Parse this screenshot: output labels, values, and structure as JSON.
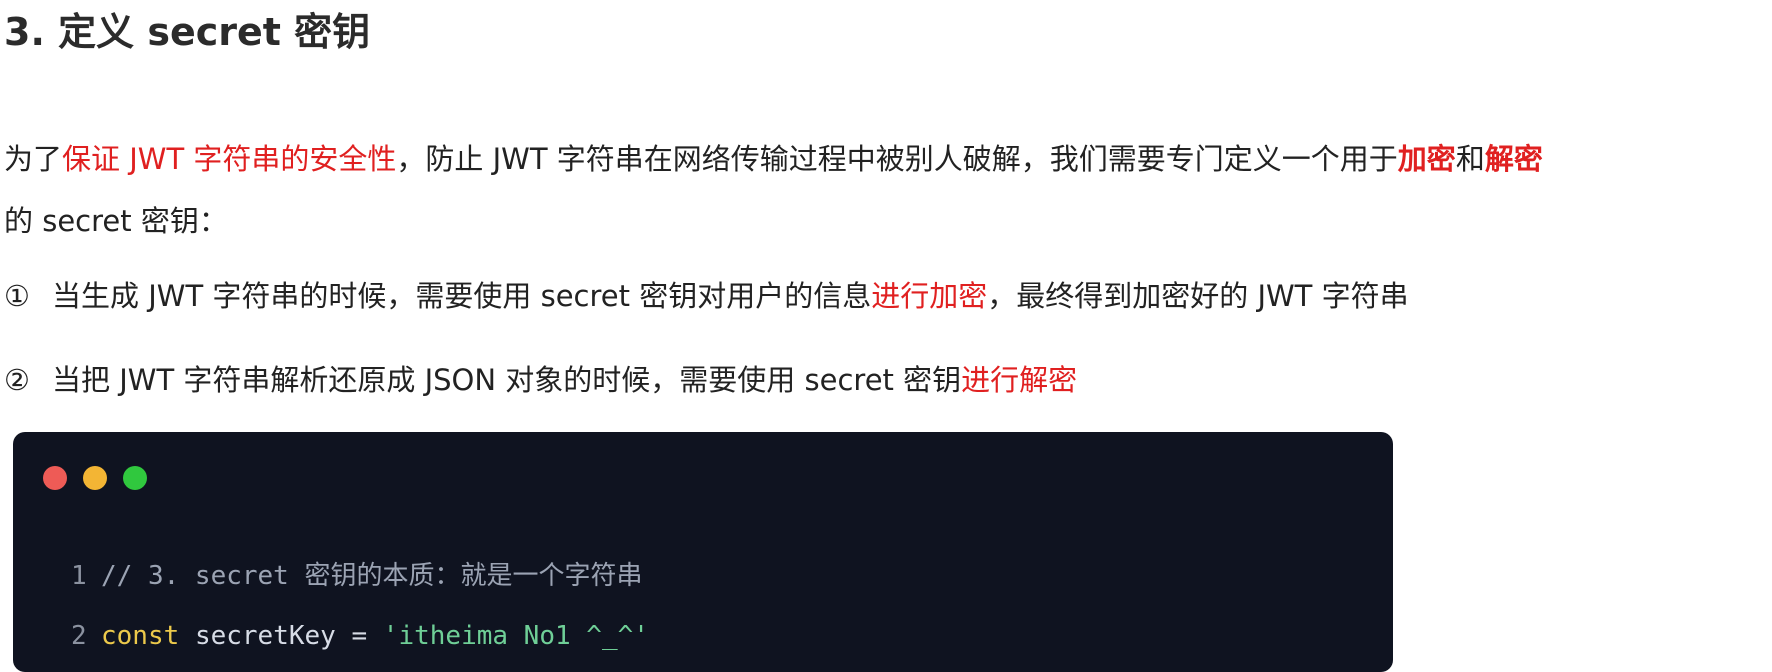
{
  "heading": "3. 定义 secret 密钥",
  "paragraph": {
    "line1": {
      "text_a": "为了",
      "red_a": "保证 JWT 字符串的安全性",
      "text_b": "，防止 JWT 字符串在网络传输过程中被别人破解，我们需要专门定义一个用于",
      "red_b": "加密",
      "text_c": "和",
      "red_c": "解密"
    },
    "line2": "的 secret 密钥："
  },
  "list": [
    {
      "marker": "①",
      "text_a": "当生成 JWT 字符串的时候，需要使用 secret 密钥对用户的信息",
      "red": "进行加密",
      "text_b": "，最终得到加密好的 JWT 字符串"
    },
    {
      "marker": "②",
      "text_a": "当把 JWT 字符串解析还原成 JSON 对象的时候，需要使用 secret 密钥",
      "red": "进行解密"
    }
  ],
  "code_window": {
    "colors": {
      "background": "#0f1320",
      "dot_red": "#ee5b56",
      "dot_yellow": "#f3b534",
      "dot_green": "#30c83e",
      "keyword": "#ecc94b",
      "string": "#6fcf97",
      "comment": "#9ba3b3"
    },
    "lines": [
      {
        "number": "1",
        "comment": "// 3. secret 密钥的本质：就是一个字符串"
      },
      {
        "number": "2",
        "keyword": "const",
        "identifier": "secretKey",
        "operator": "=",
        "string": "'itheima No1 ^_^'"
      }
    ]
  }
}
